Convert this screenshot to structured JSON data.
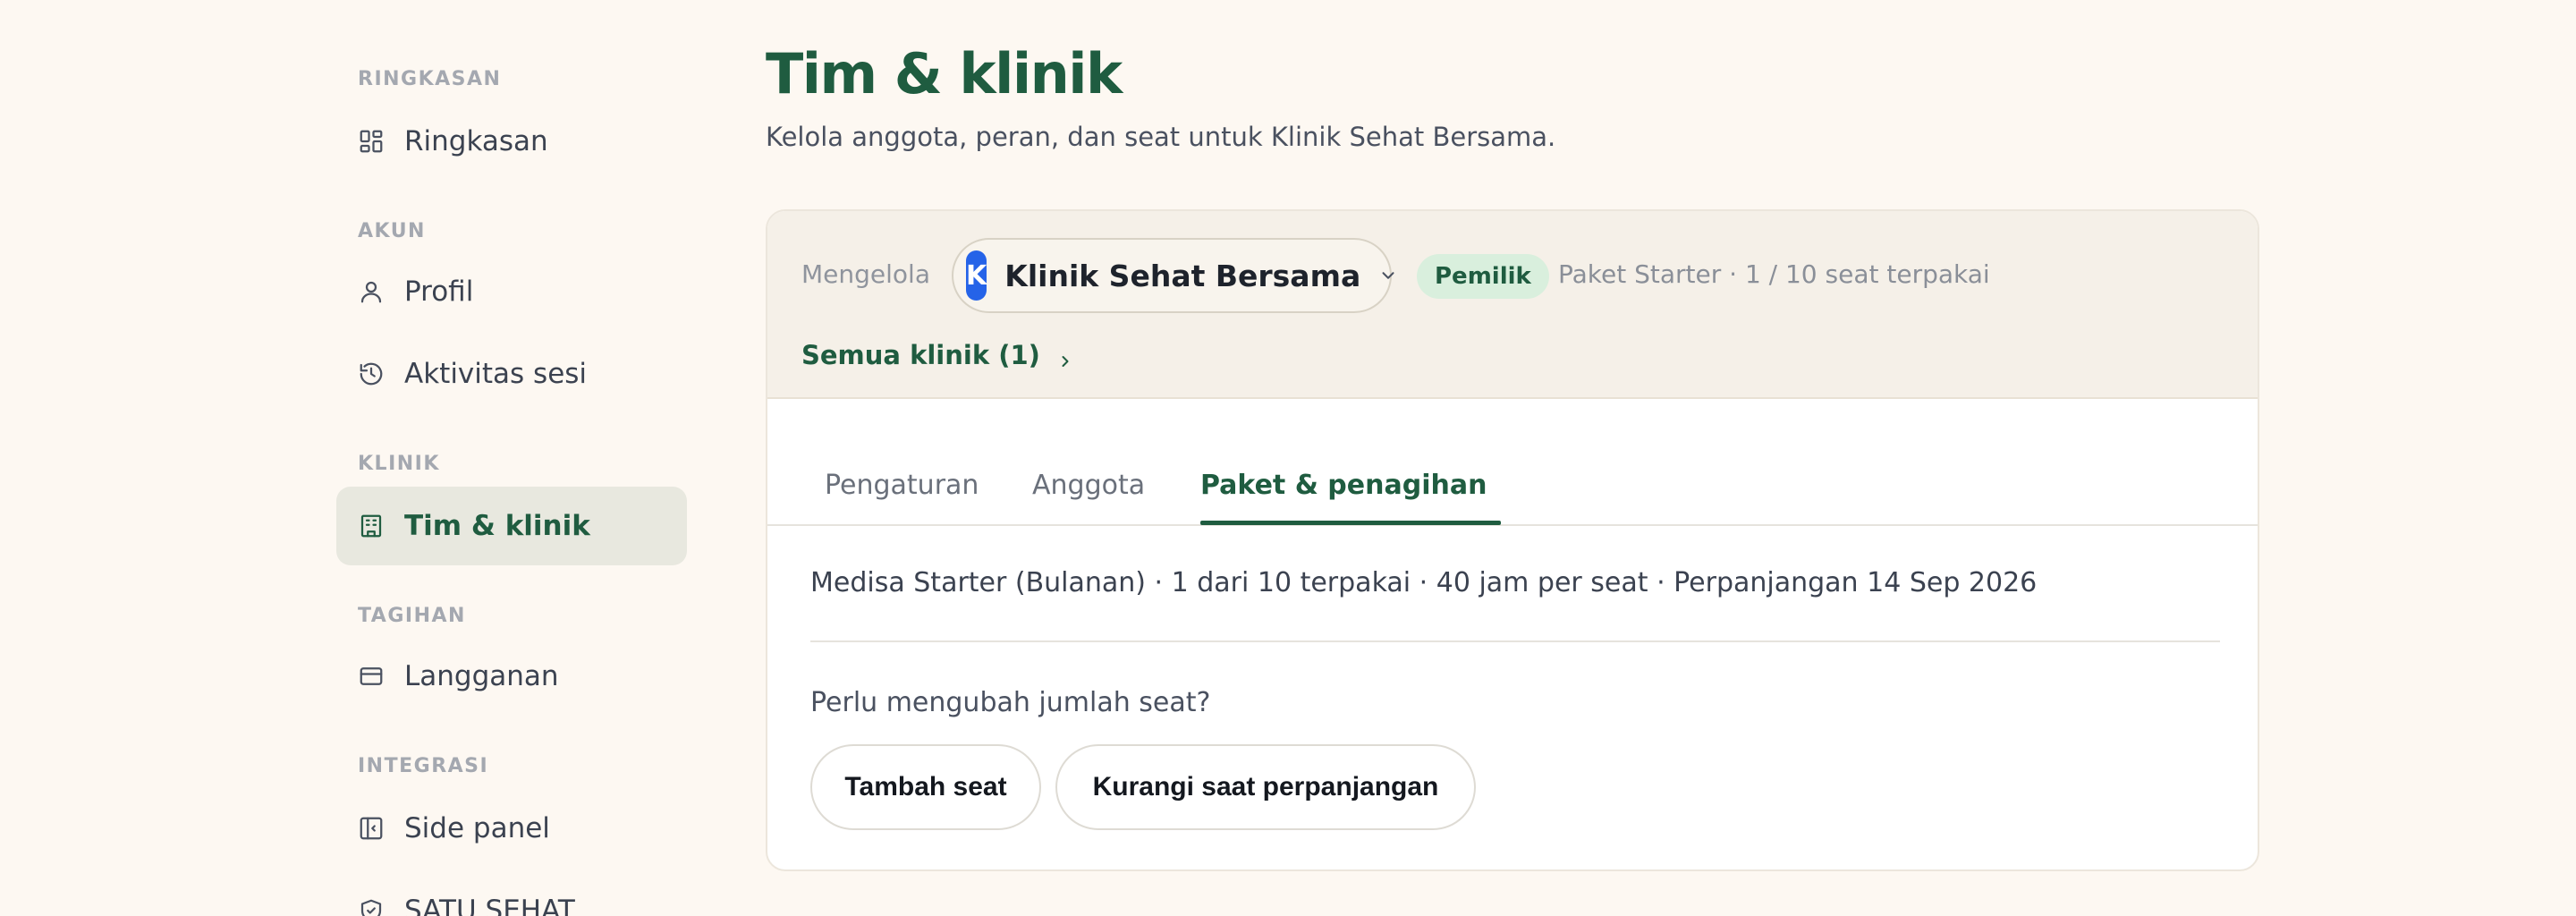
{
  "sidebar": {
    "sections": [
      {
        "title": "RINGKASAN",
        "items": [
          {
            "label": "Ringkasan",
            "icon": "dashboard-icon"
          }
        ]
      },
      {
        "title": "AKUN",
        "items": [
          {
            "label": "Profil",
            "icon": "user-icon"
          },
          {
            "label": "Aktivitas sesi",
            "icon": "history-icon"
          }
        ]
      },
      {
        "title": "KLINIK",
        "items": [
          {
            "label": "Tim & klinik",
            "icon": "building-icon",
            "active": true
          }
        ]
      },
      {
        "title": "TAGIHAN",
        "items": [
          {
            "label": "Langganan",
            "icon": "credit-card-icon"
          }
        ]
      },
      {
        "title": "INTEGRASI",
        "items": [
          {
            "label": "Side panel",
            "icon": "side-panel-icon"
          },
          {
            "label": "SATU SEHAT",
            "icon": "shield-check-icon"
          }
        ]
      }
    ]
  },
  "header": {
    "title": "Tim & klinik",
    "subtitle": "Kelola anggota, peran, dan seat untuk Klinik Sehat Bersama."
  },
  "clinic_bar": {
    "managing_label": "Mengelola",
    "avatar_letter": "K",
    "clinic_name": "Klinik Sehat Bersama",
    "role_badge": "Pemilik",
    "plan_info": "Paket Starter · 1 / 10 seat terpakai",
    "all_clinics_link": "Semua klinik (1)"
  },
  "tabs": [
    {
      "label": "Pengaturan"
    },
    {
      "label": "Anggota"
    },
    {
      "label": "Paket & penagihan",
      "active": true
    }
  ],
  "billing": {
    "plan_summary": "Medisa Starter (Bulanan) · 1 dari 10 terpakai · 40 jam per seat · Perpanjangan 14 Sep 2026",
    "seat_question": "Perlu mengubah jumlah seat?",
    "add_seat_label": "Tambah seat",
    "reduce_seat_label": "Kurangi saat perpanjangan"
  },
  "colors": {
    "brand_green": "#1f5c40",
    "avatar_blue": "#2563e8",
    "badge_bg": "#d9efdd",
    "page_bg": "#fdf8f2"
  }
}
